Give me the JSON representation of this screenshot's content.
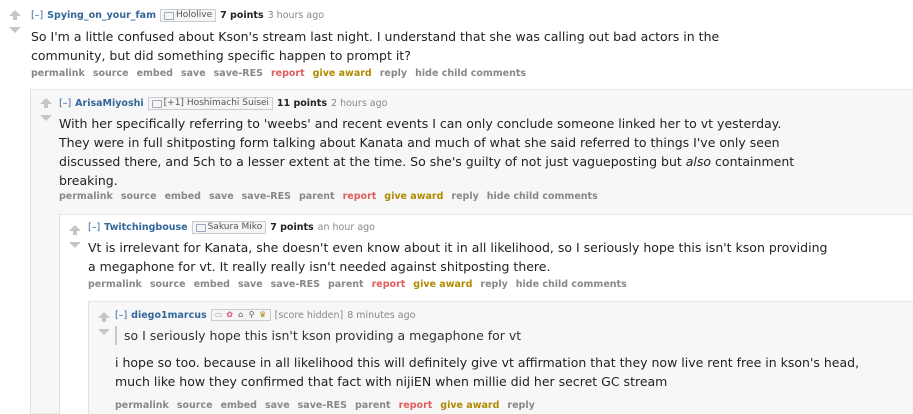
{
  "common": {
    "expand": "[–]",
    "buttons": {
      "permalink": "permalink",
      "source": "source",
      "embed": "embed",
      "save": "save",
      "save_res": "save-RES",
      "parent": "parent",
      "report": "report",
      "give_award": "give award",
      "reply": "reply",
      "hide_child": "hide child comments"
    }
  },
  "comments": [
    {
      "author": "Spying_on_your_fam",
      "flair": "Hololive",
      "score": "7 points",
      "time": "3 hours ago",
      "lines": [
        "So I'm a little confused about Kson's stream last night. I understand that she was calling out bad actors in the",
        "community, but did something specific happen to prompt it?"
      ]
    },
    {
      "author": "ArisaMiyoshi",
      "flair_prefix": "[+1]",
      "flair": "Hoshimachi Suisei",
      "score": "11 points",
      "time": "2 hours ago",
      "lines": [
        "With her specifically referring to 'weebs' and recent events I can only conclude someone linked her to vt yesterday.",
        "They were in full shitposting form talking about Kanata and much of what she said referred to things I've only seen",
        "discussed there, and 5ch to a lesser extent at the time. So she's guilty of not just vagueposting but",
        "also",
        "containment",
        "breaking."
      ]
    },
    {
      "author": "Twitchingbouse",
      "flair": "Sakura Miko",
      "score": "7 points",
      "time": "an hour ago",
      "lines": [
        "Vt is irrelevant for Kanata, she doesn't even know about it in all likelihood, so I seriously hope this isn't kson providing",
        "a megaphone for vt. It really really isn't needed against shitposting there."
      ]
    },
    {
      "author": "diego1marcus",
      "score_hidden": "[score hidden]",
      "time": "8 minutes ago",
      "quote": "so I seriously hope this isn't kson providing a megaphone for vt",
      "lines": [
        "i hope so too. because in all likelihood this will definitely give vt affirmation that they now live rent free in kson's head,",
        "much like how they confirmed that fact with nijiEN when millie did her secret GC stream"
      ]
    }
  ]
}
